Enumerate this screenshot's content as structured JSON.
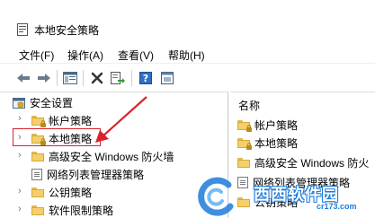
{
  "window": {
    "title": "本地安全策略"
  },
  "menu": [
    {
      "label": "文件(F)"
    },
    {
      "label": "操作(A)"
    },
    {
      "label": "查看(V)"
    },
    {
      "label": "帮助(H)"
    }
  ],
  "toolbar": {
    "buttons": [
      {
        "icon": "back-arrow-icon"
      },
      {
        "icon": "forward-arrow-icon"
      },
      {
        "icon": "show-hide-tree-icon"
      },
      {
        "icon": "delete-icon"
      },
      {
        "icon": "export-list-icon"
      },
      {
        "icon": "help-icon"
      },
      {
        "icon": "properties-icon"
      }
    ]
  },
  "tree": {
    "root": {
      "label": "安全设置"
    },
    "items": [
      {
        "label": "帐户策略",
        "icon": "lock-folder-icon",
        "expandable": true
      },
      {
        "label": "本地策略",
        "icon": "lock-folder-icon",
        "expandable": true,
        "annotated": true
      },
      {
        "label": "高级安全 Windows 防火墙",
        "icon": "folder-icon",
        "expandable": true
      },
      {
        "label": "网络列表管理器策略",
        "icon": "document-icon",
        "expandable": false
      },
      {
        "label": "公钥策略",
        "icon": "folder-icon",
        "expandable": true
      },
      {
        "label": "软件限制策略",
        "icon": "folder-icon",
        "expandable": true
      }
    ]
  },
  "list": {
    "column_header": "名称",
    "items": [
      {
        "label": "帐户策略"
      },
      {
        "label": "本地策略"
      },
      {
        "label": "高级安全 Windows 防火"
      },
      {
        "label": "网络列表管理器策略"
      },
      {
        "label": "公钥策略"
      }
    ]
  },
  "watermark": {
    "text": "西西软件园",
    "sub": "cr173.com"
  },
  "colors": {
    "annotation": "#d6242c",
    "folder": "#f4cf6b",
    "watermark": "#1e7bd9"
  }
}
